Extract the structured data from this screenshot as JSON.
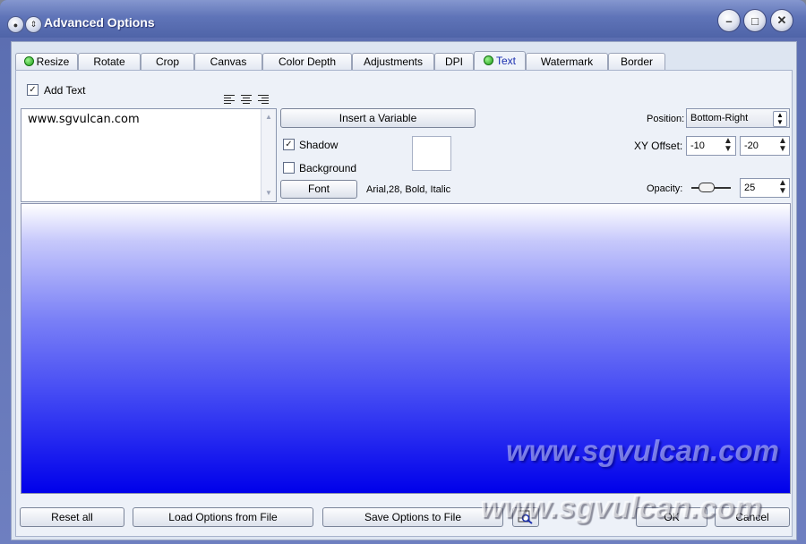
{
  "window": {
    "title": "Advanced Options"
  },
  "tabs": [
    {
      "label": "Resize",
      "indicator": true
    },
    {
      "label": "Rotate",
      "indicator": false
    },
    {
      "label": "Crop",
      "indicator": false
    },
    {
      "label": "Canvas",
      "indicator": false
    },
    {
      "label": "Color Depth",
      "indicator": false
    },
    {
      "label": "Adjustments",
      "indicator": false
    },
    {
      "label": "DPI",
      "indicator": false
    },
    {
      "label": "Text",
      "indicator": true,
      "active": true
    },
    {
      "label": "Watermark",
      "indicator": false
    },
    {
      "label": "Border",
      "indicator": false
    }
  ],
  "text_tab": {
    "add_text_label": "Add Text",
    "add_text_checked": true,
    "text_value": "www.sgvulcan.com",
    "insert_variable_label": "Insert a Variable",
    "shadow_label": "Shadow",
    "shadow_checked": true,
    "background_label": "Background",
    "background_checked": false,
    "font_button_label": "Font",
    "font_description": "Arial,28, Bold, Italic",
    "position_label": "Position:",
    "position_value": "Bottom-Right",
    "xy_offset_label": "XY Offset:",
    "x_offset": "-10",
    "y_offset": "-20",
    "opacity_label": "Opacity:",
    "opacity_value": "25"
  },
  "preview": {
    "watermark_text": "www.sgvulcan.com"
  },
  "footer": {
    "reset_all": "Reset all",
    "load_options": "Load Options from File",
    "save_options": "Save Options to File",
    "ok": "OK",
    "cancel": "Cancel"
  },
  "overlay_watermark": "www.sgvulcan.com",
  "colors": {
    "tab_indicator": "#1f9e18",
    "preview_top": "#ffffff",
    "preview_bottom": "#0000ea"
  }
}
